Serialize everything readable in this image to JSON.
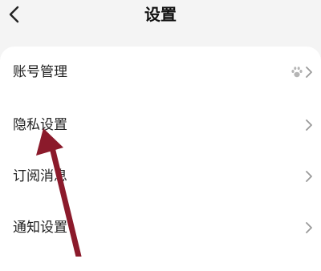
{
  "header": {
    "back_icon": "chevron-left-icon",
    "title": "设置"
  },
  "settings": {
    "items": [
      {
        "label": "账号管理",
        "trailing_icon": "baidu-paw-icon",
        "chevron_icon": "chevron-right-icon"
      },
      {
        "label": "隐私设置",
        "chevron_icon": "chevron-right-icon"
      },
      {
        "label": "订阅消息",
        "chevron_icon": "chevron-right-icon"
      },
      {
        "label": "通知设置",
        "chevron_icon": "chevron-right-icon"
      }
    ]
  },
  "annotation": {
    "arrow_color": "#8b1a2b",
    "points_to": "隐私设置"
  },
  "colors": {
    "background": "#f4f4f4",
    "card": "#ffffff",
    "chevron": "#9a9a9a"
  }
}
